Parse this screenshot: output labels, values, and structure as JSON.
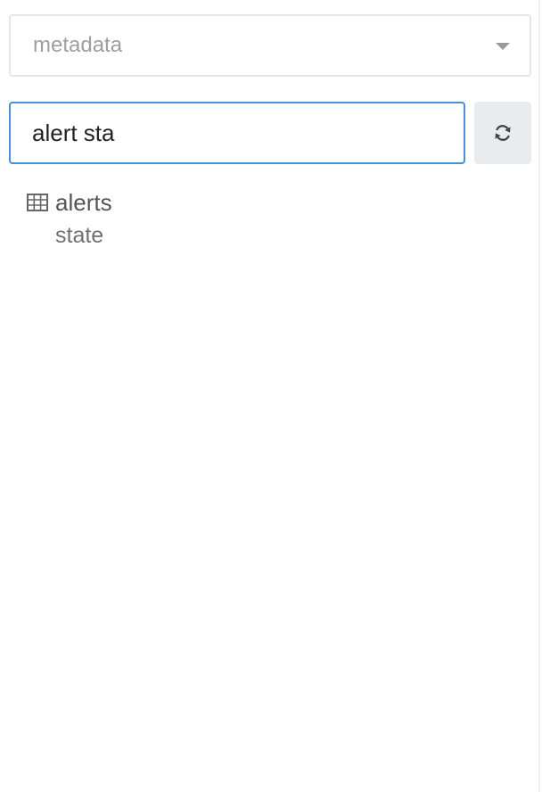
{
  "schema_select": {
    "value": "metadata",
    "icon": "chevron-down-icon"
  },
  "search": {
    "value": "alert sta",
    "refresh_icon": "refresh-icon"
  },
  "tree": {
    "tables": [
      {
        "name": "alerts",
        "icon": "table-icon",
        "columns": [
          "state"
        ]
      }
    ]
  },
  "colors": {
    "accent_border": "#4a90d9",
    "button_bg": "#e9ecef",
    "placeholder_text": "#9e9e9e"
  }
}
